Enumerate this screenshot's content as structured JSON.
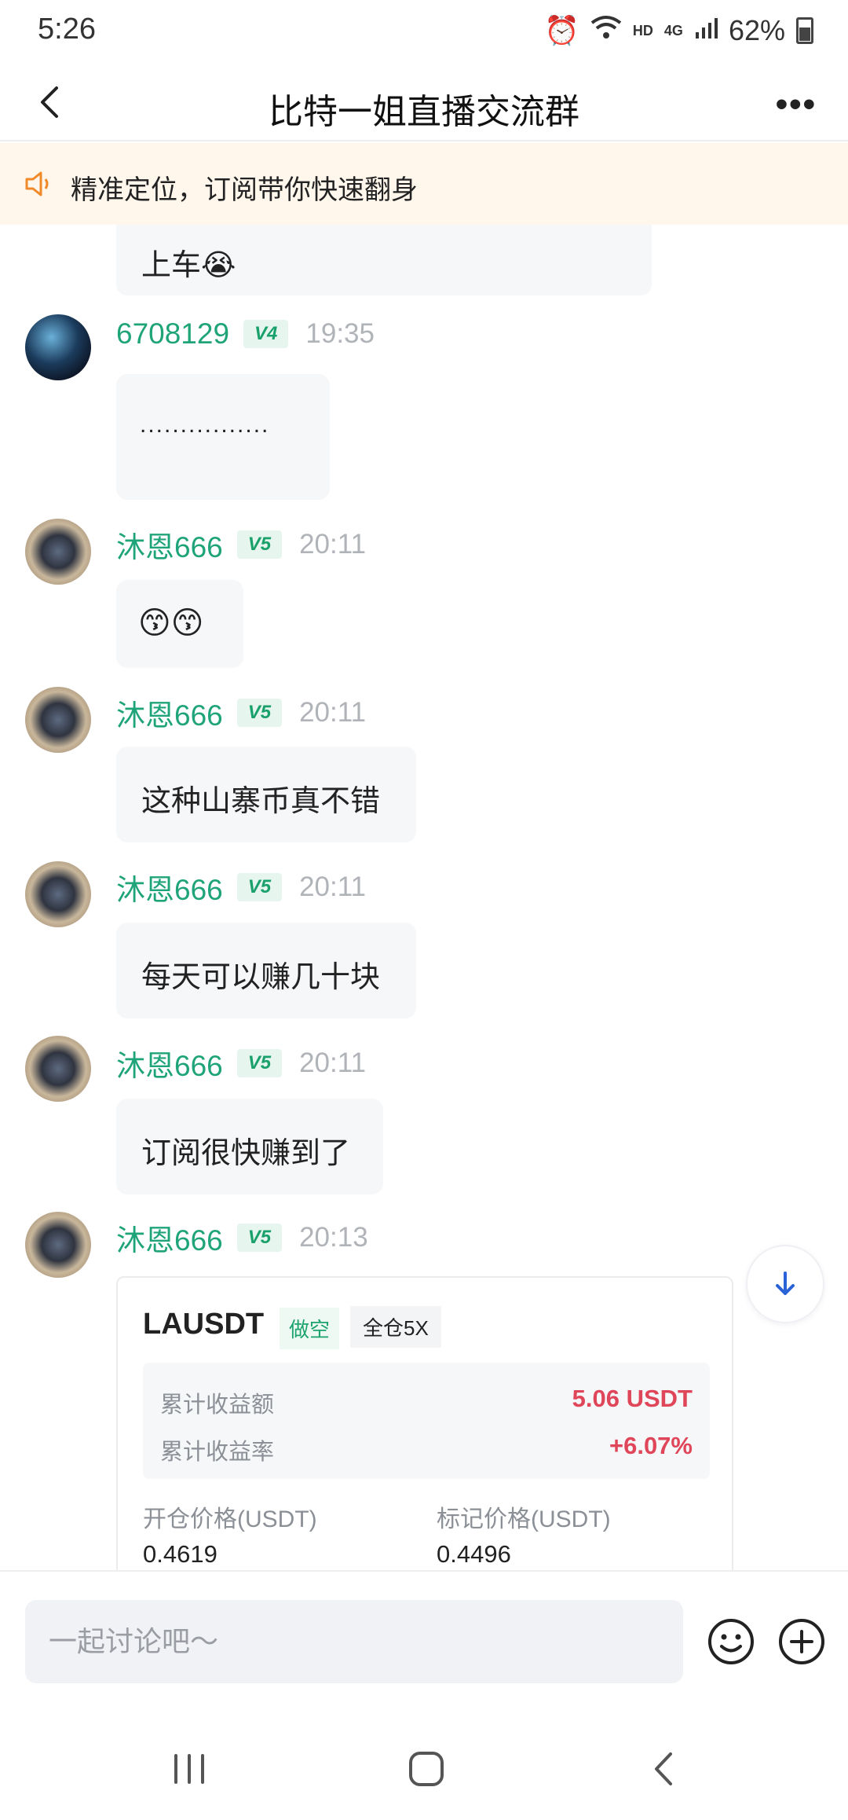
{
  "status_bar": {
    "time": "5:26",
    "hd": "HD",
    "net": "4G",
    "battery": "62%"
  },
  "header": {
    "title": "比特一姐直播交流群"
  },
  "notice": {
    "text": "精准定位，订阅带你快速翻身"
  },
  "messages": [
    {
      "text": "上车😭"
    },
    {
      "name": "6708129",
      "level": "V4",
      "time": "19:35",
      "text": "................"
    },
    {
      "name": "沐恩666",
      "level": "V5",
      "time": "20:11",
      "text": "😙😙"
    },
    {
      "name": "沐恩666",
      "level": "V5",
      "time": "20:11",
      "text": "这种山寨币真不错"
    },
    {
      "name": "沐恩666",
      "level": "V5",
      "time": "20:11",
      "text": "每天可以赚几十块"
    },
    {
      "name": "沐恩666",
      "level": "V5",
      "time": "20:11",
      "text": "订阅很快赚到了"
    },
    {
      "name": "沐恩666",
      "level": "V5",
      "time": "20:13"
    }
  ],
  "trade_card": {
    "symbol": "LAUSDT",
    "side": "做空",
    "mode": "全仓5X",
    "profit_label": "累计收益额",
    "profit_value": "5.06 USDT",
    "rate_label": "累计收益率",
    "rate_value": "+6.07%",
    "open_label": "开仓价格(USDT)",
    "open_value": "0.4619",
    "mark_label": "标记价格(USDT)",
    "mark_value": "0.4496"
  },
  "input": {
    "placeholder": "一起讨论吧～"
  },
  "colors": {
    "accent_green": "#1fa47a",
    "profit_red": "#e04659",
    "notice_bg": "#fff6ec"
  }
}
